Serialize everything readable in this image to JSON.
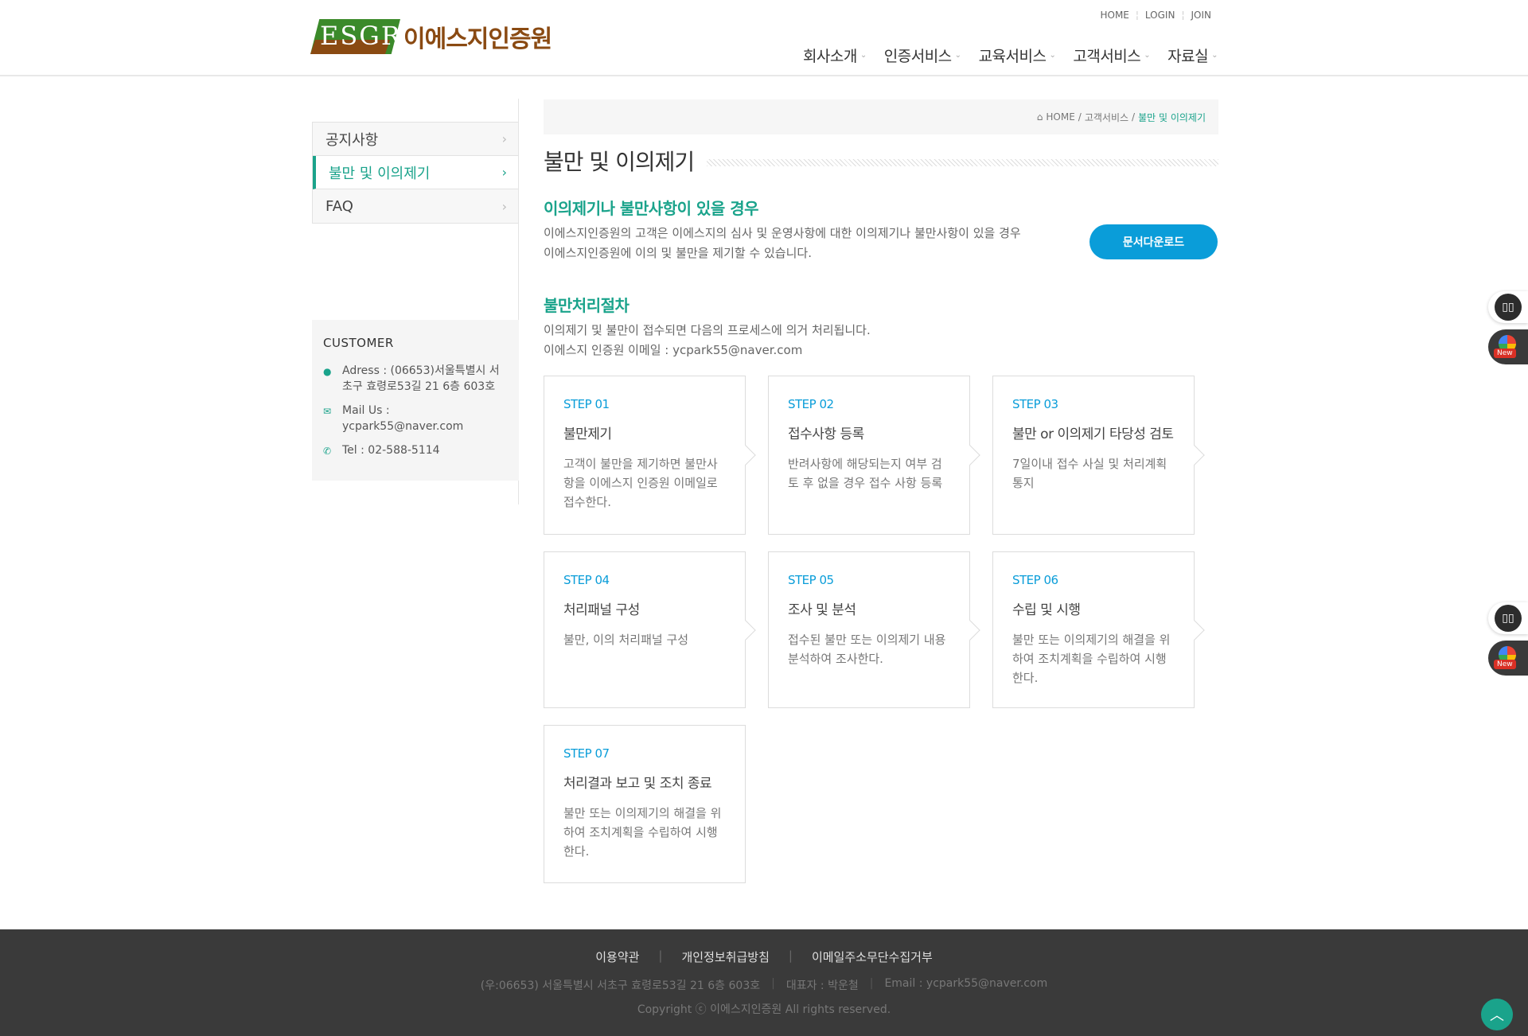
{
  "header": {
    "logo_mark": "ESGR",
    "logo_name": "이에스지인증원",
    "topnav": [
      "HOME",
      "LOGIN",
      "JOIN"
    ],
    "gnb": [
      "회사소개",
      "인증서비스",
      "교육서비스",
      "고객서비스",
      "자료실"
    ]
  },
  "sidebar": {
    "items": [
      {
        "label": "공지사항",
        "active": false
      },
      {
        "label": "불만 및 이의제기",
        "active": true
      },
      {
        "label": "FAQ",
        "active": false
      }
    ],
    "customer": {
      "heading": "CUSTOMER",
      "address": "Adress : (06653)서울특별시 서초구 효령로53길 21 6층 603호",
      "mail": "Mail Us : ycpark55@naver.com",
      "tel": "Tel : 02-588-5114"
    }
  },
  "breadcrumb": {
    "home": "HOME",
    "sep1": "/",
    "section": "고객서비스",
    "sep2": "/",
    "current": "불만 및 이의제기"
  },
  "main": {
    "page_title": "불만 및 이의제기",
    "section1_title": "이의제기나 불만사항이 있을 경우",
    "section1_line1": "이에스지인증원의 고객은 이에스지의 심사 및 운영사항에 대한 이의제기나 불만사항이 있을 경우",
    "section1_line2": "이에스지인증원에 이의 및 불만을 제기할 수 있습니다.",
    "download_button": "문서다운로드",
    "section2_title": "불만처리절차",
    "section2_line1": "이의제기 및 불만이 접수되면 다음의 프로세스에 의거 처리됩니다.",
    "section2_line2": "이에스지 인증원 이메일 : ycpark55@naver.com",
    "steps": [
      {
        "num": "STEP 01",
        "title": "불만제기",
        "desc": "고객이 불만을 제기하면 불만사항을 이에스지 인증원 이메일로 접수한다."
      },
      {
        "num": "STEP 02",
        "title": "접수사항 등록",
        "desc": "반려사항에 해당되는지 여부 검토 후 없을 경우 접수 사항 등록"
      },
      {
        "num": "STEP 03",
        "title": "불만 or 이의제기 타당성 검토",
        "desc": "7일이내 접수 사실 및 처리계획 통지"
      },
      {
        "num": "STEP 04",
        "title": "처리패널 구성",
        "desc": "불만, 이의 처리패널 구성"
      },
      {
        "num": "STEP 05",
        "title": "조사 및 분석",
        "desc": "접수된 불만 또는 이의제기 내용 분석하여 조사한다."
      },
      {
        "num": "STEP 06",
        "title": "수립 및 시행",
        "desc": "불만 또는 이의제기의 해결을 위하여 조치계획을 수립하여 시행한다."
      },
      {
        "num": "STEP 07",
        "title": "처리결과 보고 및 조치 종료",
        "desc": "불만 또는 이의제기의 해결을 위하여 조치계획을 수립하여 시행한다."
      }
    ]
  },
  "widgets": {
    "new_badge": "New"
  },
  "footer": {
    "links": [
      "이용약관",
      "개인정보취급방침",
      "이메일주소무단수집거부"
    ],
    "address": "(우:06653) 서울특별시 서초구 효령로53길 21 6층 603호",
    "ceo": "대표자 : 박운철",
    "email": "Email : ycpark55@naver.com",
    "copyright": "Copyright ⓒ 이에스지인증원 All rights reserved."
  },
  "colors": {
    "accent": "#1aa38b",
    "button": "#0a9dd9",
    "footer_bg": "#3a3a3a"
  }
}
